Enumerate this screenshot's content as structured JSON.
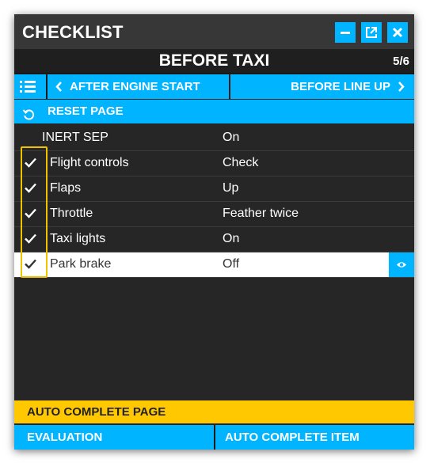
{
  "window": {
    "title": "CHECKLIST",
    "buttons": {
      "minimize": "minimize-icon",
      "popout": "popout-icon",
      "close": "close-icon"
    }
  },
  "page": {
    "name": "BEFORE TAXI",
    "counter": "5/6"
  },
  "nav": {
    "menu_icon": "list-icon",
    "prev_label": "AFTER ENGINE START",
    "next_label": "BEFORE LINE UP"
  },
  "reset": {
    "label": "RESET PAGE",
    "icon": "reset-icon"
  },
  "items": [
    {
      "label": "INERT SEP",
      "value": "On",
      "checked": false
    },
    {
      "label": "Flight controls",
      "value": "Check",
      "checked": true
    },
    {
      "label": "Flaps",
      "value": "Up",
      "checked": true
    },
    {
      "label": "Throttle",
      "value": "Feather twice",
      "checked": true
    },
    {
      "label": "Taxi lights",
      "value": "On",
      "checked": true
    },
    {
      "label": "Park brake",
      "value": "Off",
      "checked": true,
      "current": true
    }
  ],
  "footer": {
    "auto_complete_page": "AUTO COMPLETE PAGE",
    "evaluation": "EVALUATION",
    "auto_complete_item": "AUTO COMPLETE ITEM"
  },
  "colors": {
    "accent": "#00b4ff",
    "highlight": "#ffc800",
    "panel": "#262626"
  }
}
